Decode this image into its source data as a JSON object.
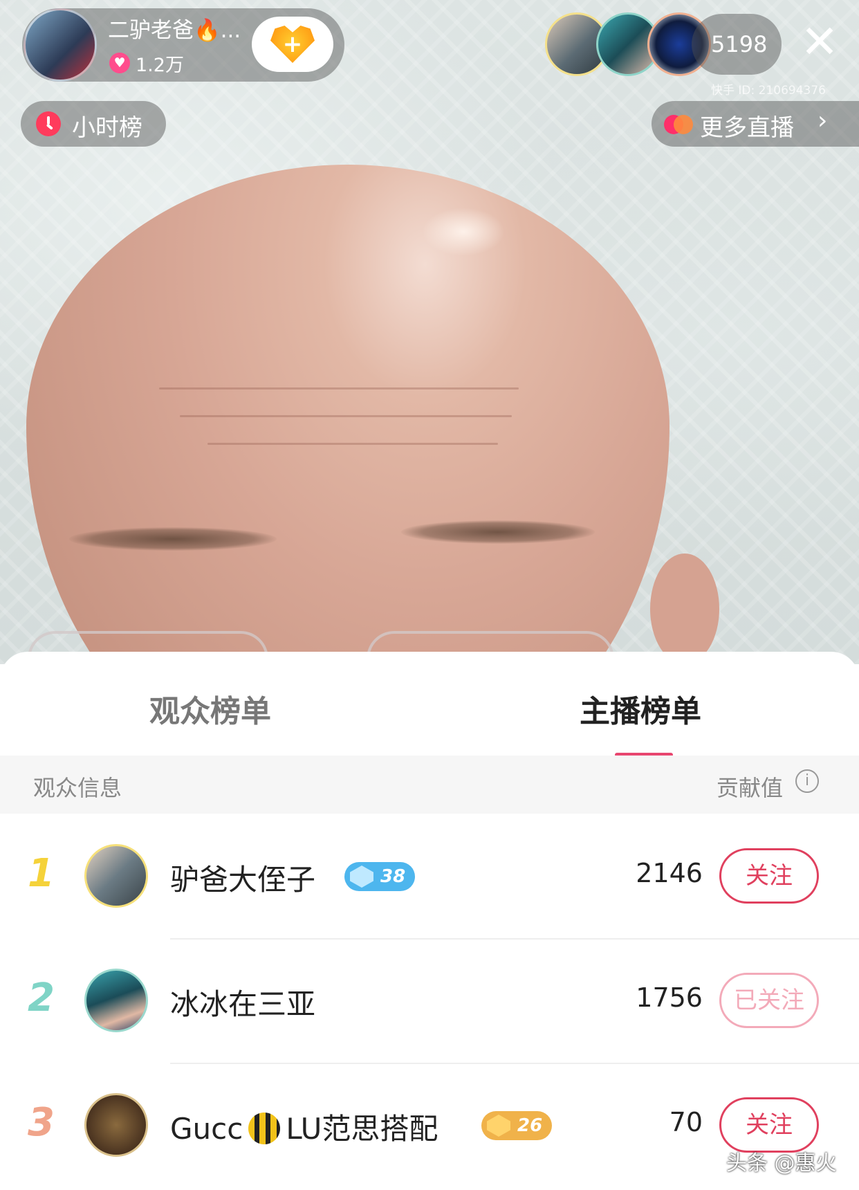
{
  "stream": {
    "anchor_name": "二驴老爸🔥...",
    "likes": "1.2万",
    "viewer_count": "5198",
    "kuaishou_id": "快手 ID: 210694376",
    "hourly_rank_label": "小时榜",
    "more_live_label": "更多直播",
    "follow_plus": "+",
    "close_symbol": "✕",
    "chevron": "›"
  },
  "sheet": {
    "tabs": [
      {
        "label": "观众榜单",
        "active": false
      },
      {
        "label": "主播榜单",
        "active": true
      }
    ],
    "header_left": "观众信息",
    "header_right": "贡献值",
    "info_symbol": "i"
  },
  "rows": [
    {
      "rank": "1",
      "name": "驴爸大侄子",
      "level": "38",
      "score": "2146",
      "button": "关注",
      "rank_color": "#f5d23a",
      "level_color": "#4db6ee"
    },
    {
      "rank": "2",
      "name": "冰冰在三亚",
      "level": "",
      "score": "1756",
      "button": "已关注",
      "rank_color": "#7fd4c6"
    },
    {
      "rank": "3",
      "name_prefix": "Gucc",
      "name_suffix": "LU范思搭配",
      "level": "26",
      "score": "70",
      "button": "关注",
      "rank_color": "#f0a48a",
      "level_color": "#f0b24a"
    }
  ],
  "watermark": "头条 @惠火"
}
